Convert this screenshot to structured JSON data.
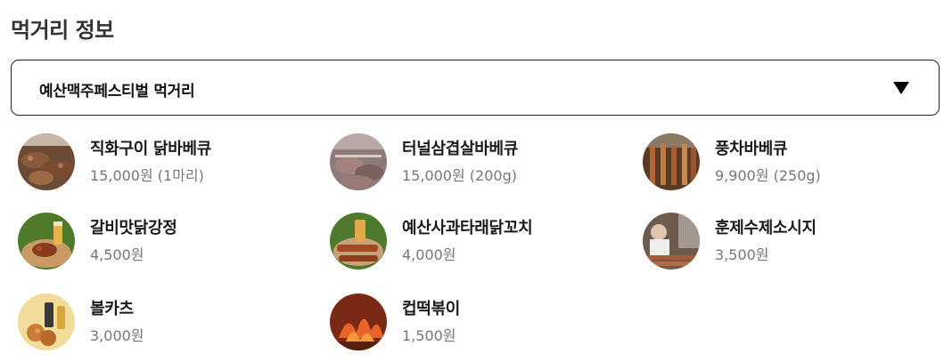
{
  "section_title": "먹거리 정보",
  "dropdown": {
    "selected": "예산맥주페스티벌 먹거리",
    "icon": "caret-down-icon"
  },
  "foods": [
    {
      "name": "직화구이 닭바베큐",
      "price": "15,000원 (1마리)",
      "photo": "grilled-chicken-photo"
    },
    {
      "name": "터널삼겹살바베큐",
      "price": "15,000원 (200g)",
      "photo": "pork-belly-photo"
    },
    {
      "name": "풍차바베큐",
      "price": "9,900원 (250g)",
      "photo": "windmill-bbq-photo"
    },
    {
      "name": "갈비맛닭강정",
      "price": "4,500원",
      "photo": "galbi-chicken-photo"
    },
    {
      "name": "예산사과타래닭꼬치",
      "price": "4,000원",
      "photo": "chicken-skewer-photo"
    },
    {
      "name": "훈제수제소시지",
      "price": "3,500원",
      "photo": "smoked-sausage-photo"
    },
    {
      "name": "볼카츠",
      "price": "3,000원",
      "photo": "ball-katsu-photo"
    },
    {
      "name": "컵떡볶이",
      "price": "1,500원",
      "photo": "cup-tteokbokki-photo"
    }
  ]
}
